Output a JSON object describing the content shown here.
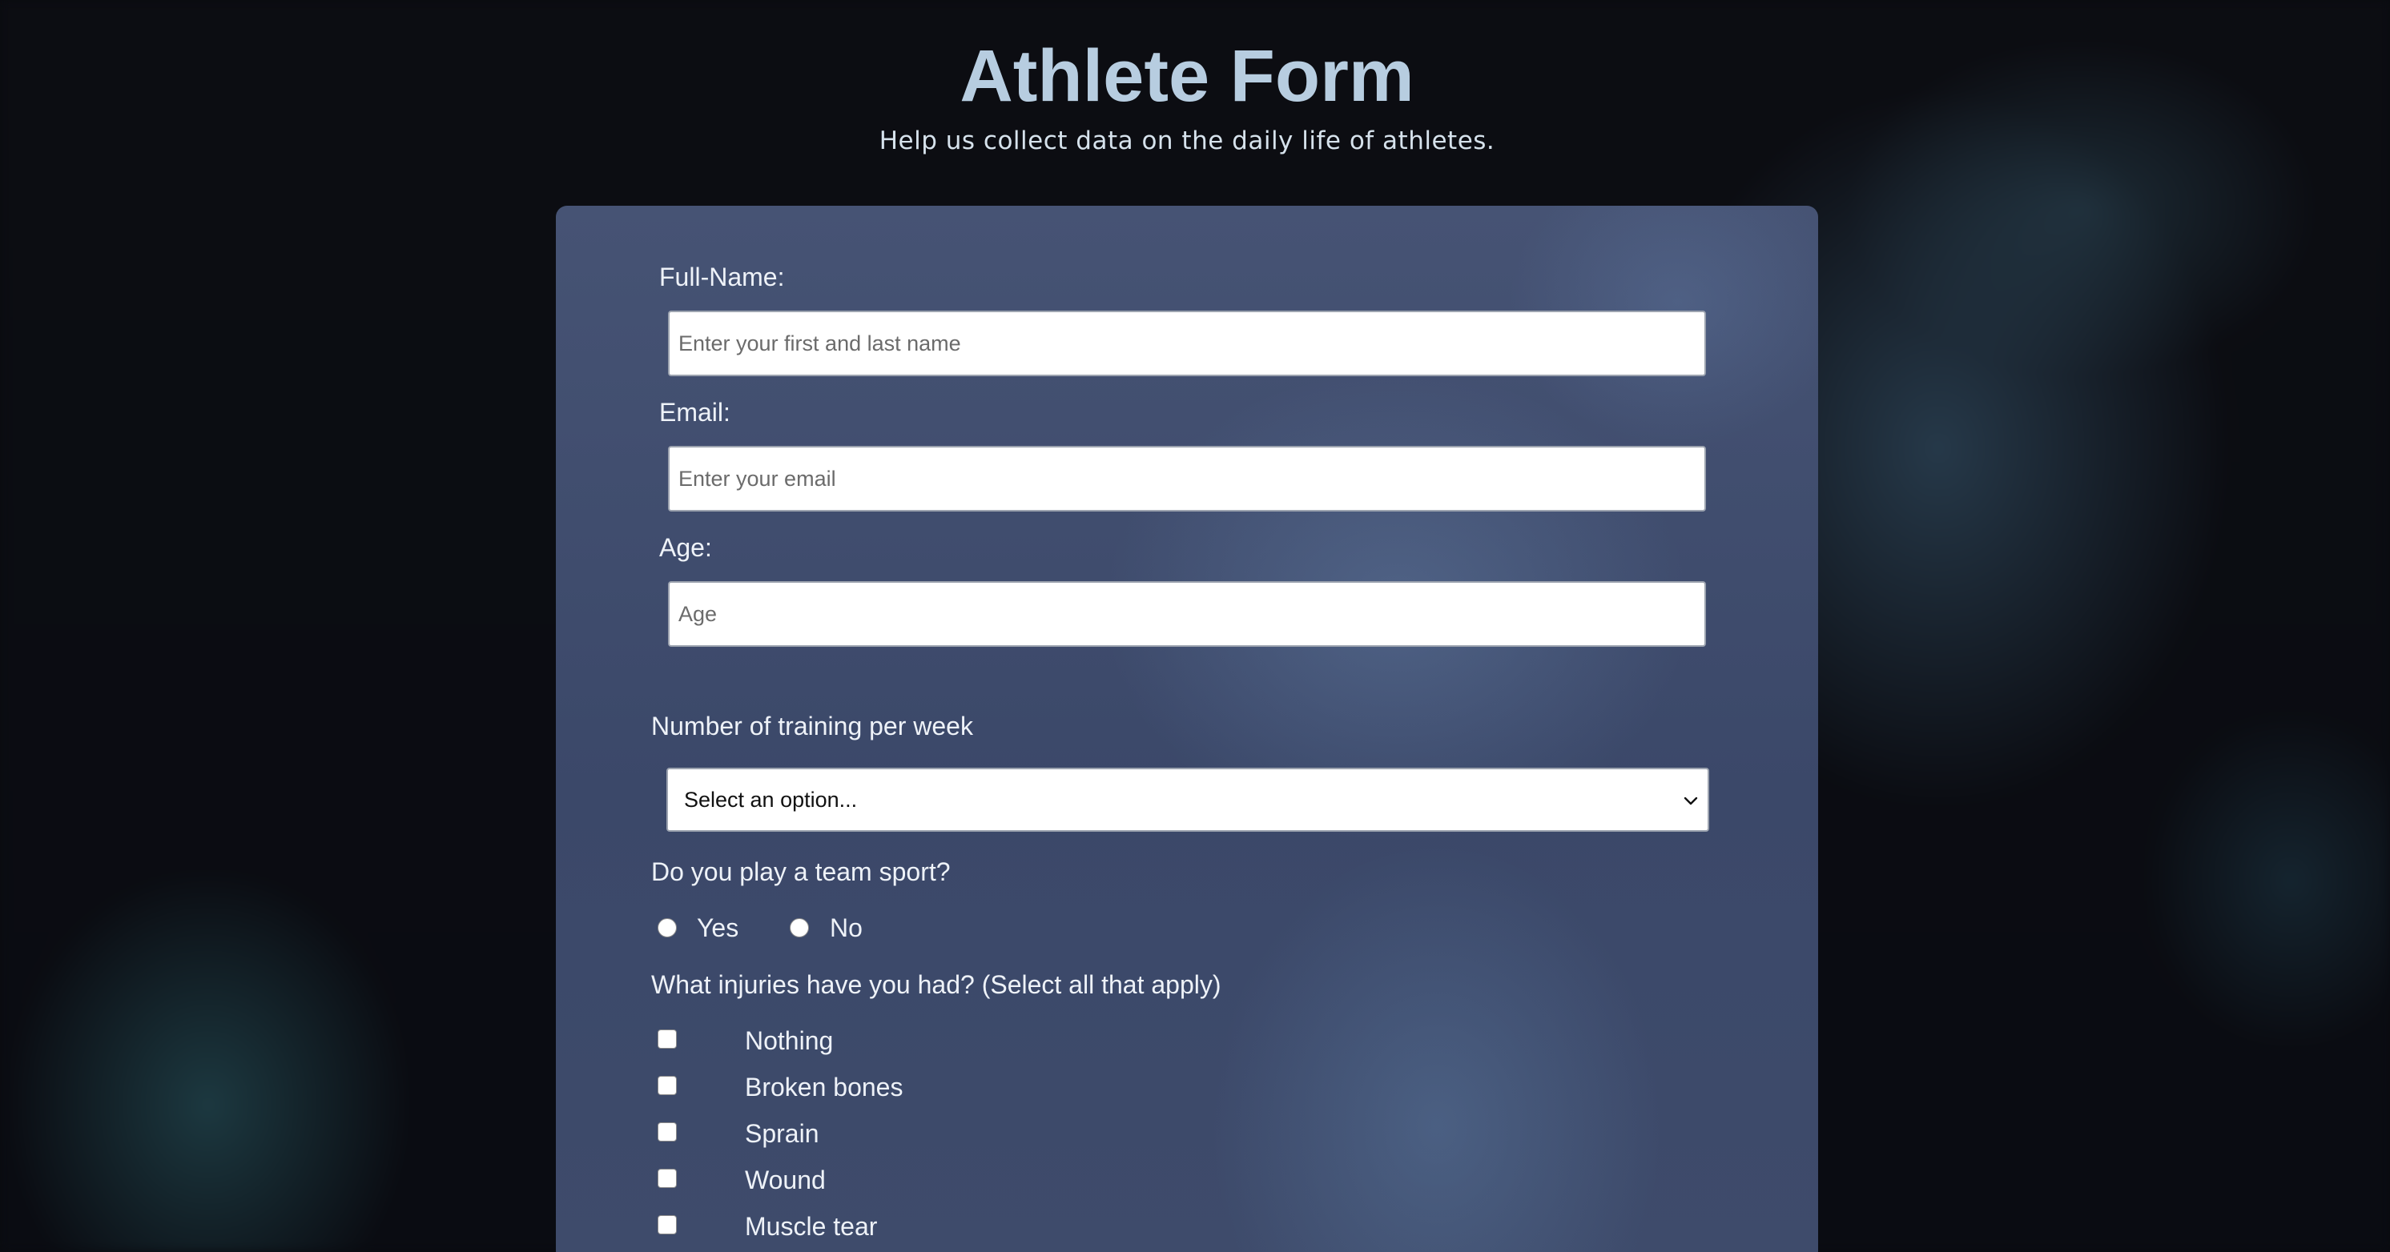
{
  "header": {
    "title": "Athlete Form",
    "subtitle": "Help us collect data on the daily life of athletes."
  },
  "form": {
    "full_name": {
      "label": "Full-Name:",
      "placeholder": "Enter your first and last name",
      "value": ""
    },
    "email": {
      "label": "Email:",
      "placeholder": "Enter your email",
      "value": ""
    },
    "age": {
      "label": "Age:",
      "placeholder": "Age",
      "value": ""
    },
    "training": {
      "label": "Number of training per week",
      "selected": "Select an option..."
    },
    "team_sport": {
      "question": "Do you play a team sport?",
      "options": [
        "Yes",
        "No"
      ]
    },
    "injuries": {
      "question": "What injuries have you had? (Select all that apply)",
      "options": [
        "Nothing",
        "Broken bones",
        "Sprain",
        "Wound",
        "Muscle tear"
      ]
    }
  },
  "icons": {
    "dropdown": "chevron-down-icon"
  },
  "colors": {
    "title": "#b7cde0",
    "card": "#3f4c6d",
    "page_background": "#0a0b10"
  }
}
